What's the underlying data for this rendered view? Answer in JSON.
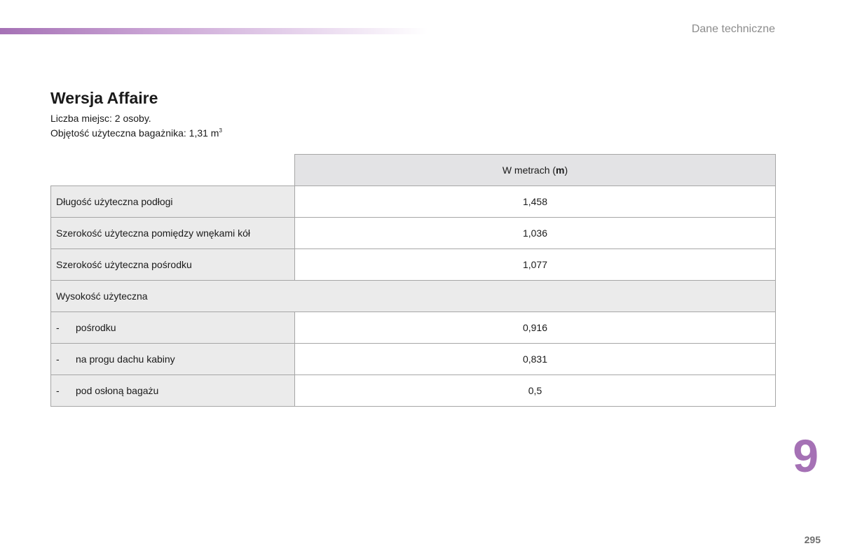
{
  "header": {
    "section_name": "Dane techniczne"
  },
  "title": "Wersja Affaire",
  "info": {
    "seats": "Liczba miejsc: 2 osoby.",
    "volume": "Objętość użyteczna bagażnika: 1,31 m",
    "volume_sup": "3"
  },
  "table": {
    "header_prefix": "W metrach (",
    "header_unit": "m",
    "header_suffix": ")",
    "rows": [
      {
        "label": "Długość użyteczna podłogi",
        "value": "1,458"
      },
      {
        "label": "Szerokość użyteczna pomiędzy wnękami kół",
        "value": "1,036"
      },
      {
        "label": "Szerokość użyteczna pośrodku",
        "value": "1,077"
      }
    ],
    "group_label": "Wysokość użyteczna",
    "sub_rows": [
      {
        "dash": "-",
        "label": "pośrodku",
        "value": "0,916"
      },
      {
        "dash": "-",
        "label": "na progu dachu kabiny",
        "value": "0,831"
      },
      {
        "dash": "-",
        "label": "pod osłoną bagażu",
        "value": "0,5"
      }
    ]
  },
  "chapter_number": "9",
  "page_number": "295",
  "colors": {
    "accent": "#a571b5",
    "label_cell_bg": "#ebebeb",
    "header_cell_bg": "#e3e3e5"
  }
}
